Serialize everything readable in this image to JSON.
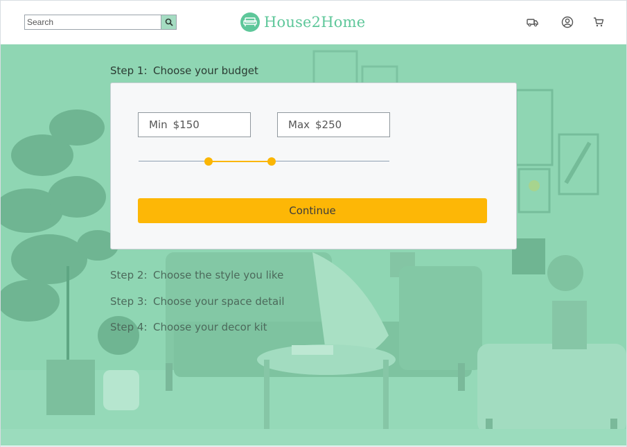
{
  "header": {
    "search": {
      "placeholder": "Search",
      "value": ""
    },
    "logo_text": "House2Home",
    "icons": [
      "delivery-truck-icon",
      "user-account-icon",
      "cart-icon"
    ]
  },
  "steps": {
    "active": {
      "label": "Step 1:",
      "title": "Choose your budget"
    },
    "upcoming": [
      {
        "label": "Step 2:",
        "title": "Choose the style you like"
      },
      {
        "label": "Step 3:",
        "title": "Choose your space detail"
      },
      {
        "label": "Step 4:",
        "title": "Choose your decor kit"
      }
    ]
  },
  "budget": {
    "min_label": "Min",
    "min_value": "$150",
    "max_label": "Max",
    "max_value": "$250",
    "range_low_fraction": 0.28,
    "range_high_fraction": 0.53,
    "continue_label": "Continue"
  },
  "colors": {
    "brand": "#5ec79a",
    "accent": "#fbb604",
    "hero_overlay": "#8fd6b3"
  }
}
